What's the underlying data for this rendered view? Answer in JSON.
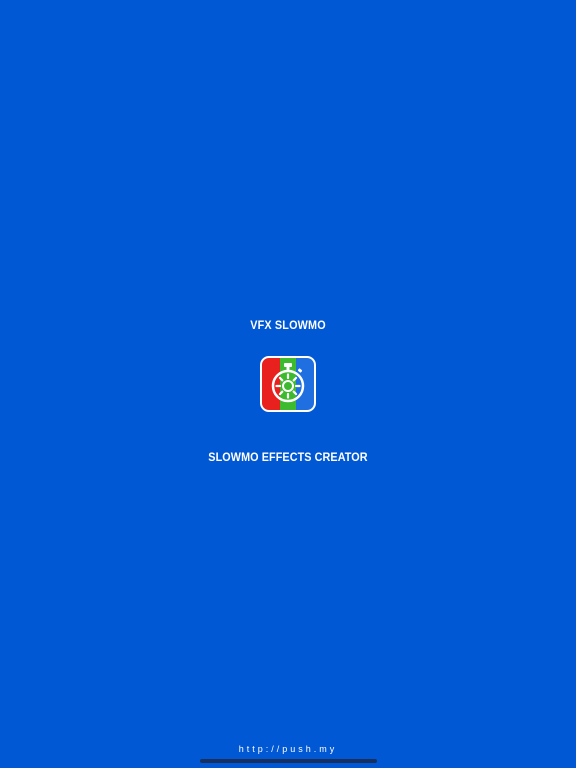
{
  "splash": {
    "app_name": "VFX SLOWMO",
    "tagline": "SLOWMO EFFECTS CREATOR",
    "footer_url": "http://push.my",
    "icon": "stopwatch-icon"
  },
  "colors": {
    "background": "#0058D4",
    "text": "#FFFFFF",
    "icon_red": "#E8201E",
    "icon_green": "#3DBA2E",
    "icon_blue": "#1F6FE0"
  }
}
